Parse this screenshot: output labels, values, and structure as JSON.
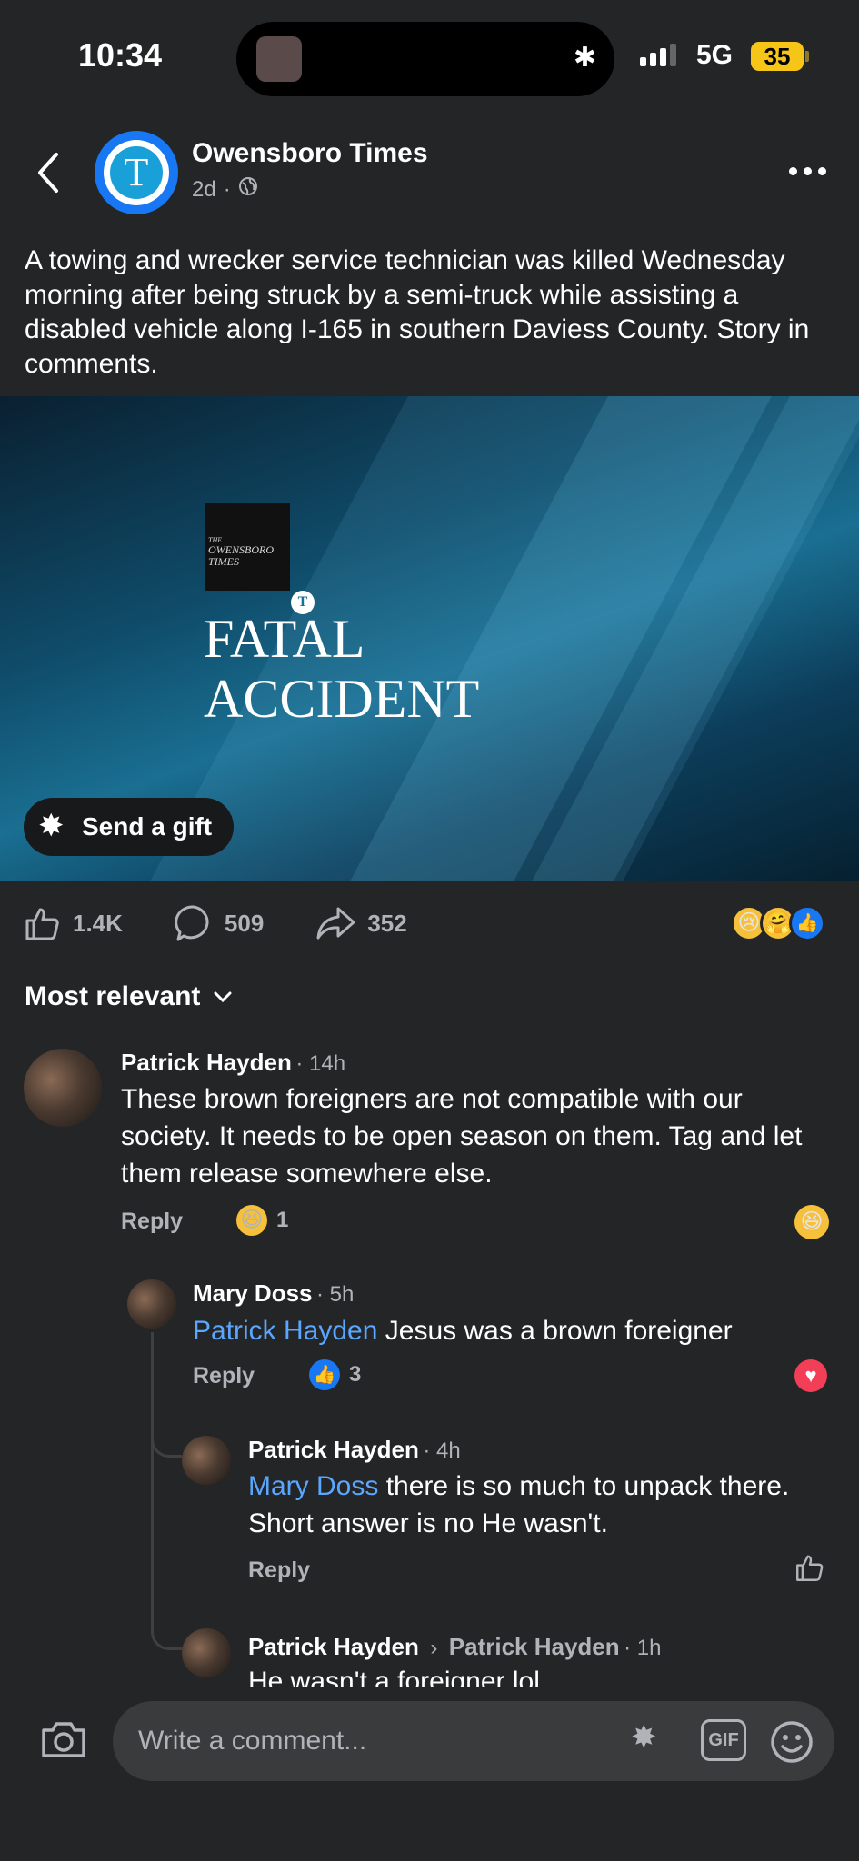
{
  "status_bar": {
    "time": "10:34",
    "network": "5G",
    "battery": "35"
  },
  "post": {
    "page_name": "Owensboro Times",
    "age": "2d",
    "audience_icon": "globe-icon",
    "text": "A towing and wrecker service technician was killed Wednesday morning after being struck by a semi-truck while assisting a disabled vehicle along I-165 in southern Daviess County. Story in comments.",
    "image": {
      "logo_line1": "THE",
      "logo_line2": "OWENSBORO",
      "logo_line3": "TIMES",
      "headline_line1": "FATAL",
      "headline_line2": "ACCIDENT"
    },
    "gift_label": "Send a gift",
    "stats": {
      "likes": "1.4K",
      "comments": "509",
      "shares": "352"
    }
  },
  "sort_label": "Most relevant",
  "comments": [
    {
      "author": "Patrick Hayden",
      "time": "14h",
      "text": "These brown foreigners are not compatible with our society. It needs to be open season on them. Tag and let them release somewhere else.",
      "reply_label": "Reply",
      "reaction_count": "1"
    },
    {
      "author": "Mary Doss",
      "time": "5h",
      "mention": "Patrick Hayden",
      "text": "Jesus was a brown foreigner",
      "reply_label": "Reply",
      "reaction_count": "3"
    },
    {
      "author": "Patrick Hayden",
      "time": "4h",
      "mention": "Mary Doss",
      "text": "there is so much to unpack there. Short answer is no He wasn't.",
      "reply_label": "Reply"
    },
    {
      "author": "Patrick Hayden",
      "reply_to": "Patrick Hayden",
      "time": "1h",
      "text": "He wasn't a foreigner lol"
    }
  ],
  "composer": {
    "placeholder": "Write a comment...",
    "gif_label": "GIF"
  }
}
